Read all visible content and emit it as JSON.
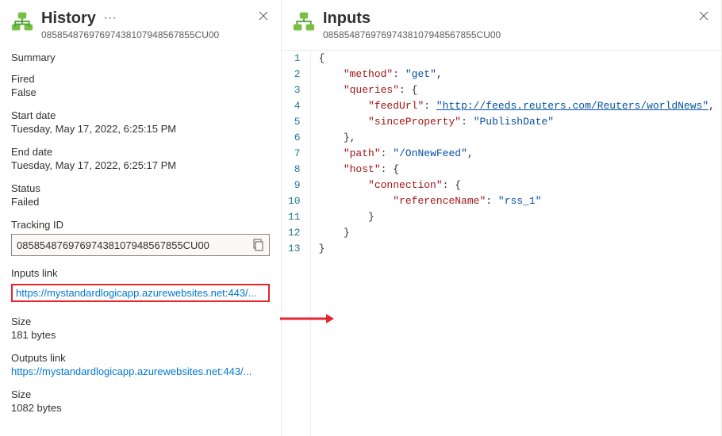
{
  "history": {
    "title": "History",
    "id": "08585487697697438107948567855CU00",
    "summary_label": "Summary",
    "fields": {
      "fired_label": "Fired",
      "fired_value": "False",
      "start_label": "Start date",
      "start_value": "Tuesday, May 17, 2022, 6:25:15 PM",
      "end_label": "End date",
      "end_value": "Tuesday, May 17, 2022, 6:25:17 PM",
      "status_label": "Status",
      "status_value": "Failed",
      "tracking_label": "Tracking ID",
      "tracking_value": "08585487697697438107948567855CU00",
      "inputs_link_label": "Inputs link",
      "inputs_link_value": "https://mystandardlogicapp.azurewebsites.net:443/...",
      "inputs_size_label": "Size",
      "inputs_size_value": "181 bytes",
      "outputs_link_label": "Outputs link",
      "outputs_link_value": "https://mystandardlogicapp.azurewebsites.net:443/...",
      "outputs_size_label": "Size",
      "outputs_size_value": "1082 bytes"
    }
  },
  "inputs": {
    "title": "Inputs",
    "id": "08585487697697438107948567855CU00",
    "code": [
      {
        "n": "1",
        "text": "{"
      },
      {
        "n": "2",
        "text": "    \"method\": \"get\","
      },
      {
        "n": "3",
        "text": "    \"queries\": {"
      },
      {
        "n": "4",
        "text": "        \"feedUrl\": \"http://feeds.reuters.com/Reuters/worldNews\","
      },
      {
        "n": "5",
        "text": "        \"sinceProperty\": \"PublishDate\""
      },
      {
        "n": "6",
        "text": "    },"
      },
      {
        "n": "7",
        "text": "    \"path\": \"/OnNewFeed\","
      },
      {
        "n": "8",
        "text": "    \"host\": {"
      },
      {
        "n": "9",
        "text": "        \"connection\": {"
      },
      {
        "n": "10",
        "text": "            \"referenceName\": \"rss_1\""
      },
      {
        "n": "11",
        "text": "        }"
      },
      {
        "n": "12",
        "text": "    }"
      },
      {
        "n": "13",
        "text": "}"
      }
    ],
    "json_data": {
      "method": "get",
      "queries": {
        "feedUrl": "http://feeds.reuters.com/Reuters/worldNews",
        "sinceProperty": "PublishDate"
      },
      "path": "/OnNewFeed",
      "host": {
        "connection": {
          "referenceName": "rss_1"
        }
      }
    }
  }
}
